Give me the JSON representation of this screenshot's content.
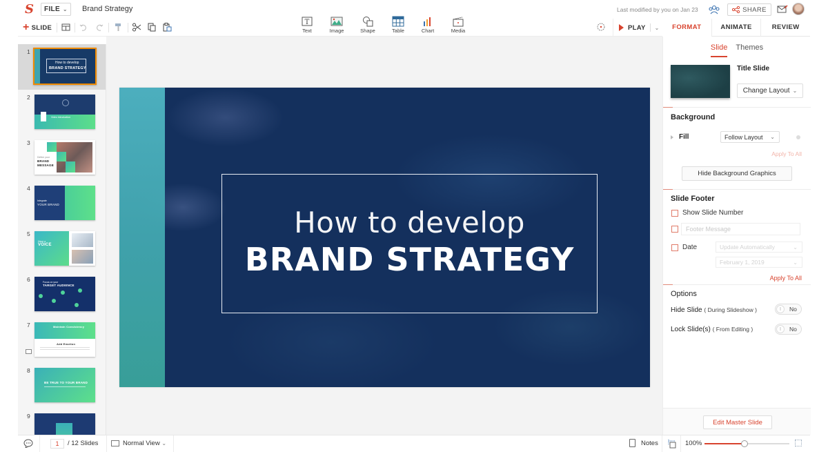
{
  "app": {
    "logo_glyph": "S",
    "file_menu_label": "FILE",
    "document_title": "Brand Strategy",
    "last_modified": "Last modified by you on Jan 23",
    "share_label": "SHARE"
  },
  "toolbar": {
    "add_slide_label": "SLIDE",
    "insert_items": [
      {
        "label": "Text",
        "icon": "text-box-icon"
      },
      {
        "label": "Image",
        "icon": "image-icon"
      },
      {
        "label": "Shape",
        "icon": "shape-icon"
      },
      {
        "label": "Table",
        "icon": "table-icon"
      },
      {
        "label": "Chart",
        "icon": "chart-icon"
      },
      {
        "label": "Media",
        "icon": "media-icon"
      }
    ],
    "play_label": "PLAY"
  },
  "right_tabs": [
    {
      "label": "FORMAT",
      "active": true
    },
    {
      "label": "ANIMATE",
      "active": false
    },
    {
      "label": "REVIEW",
      "active": false
    }
  ],
  "slides": [
    {
      "number": "1",
      "title_line1": "How to develop",
      "title_line2": "BRAND STRATEGY",
      "selected": true
    },
    {
      "number": "2",
      "caption": "Video introduction"
    },
    {
      "number": "3",
      "title": "BRAND MESSAGE",
      "kicker": "Define your"
    },
    {
      "number": "4",
      "title": "YOUR BRAND",
      "kicker": "Integrate"
    },
    {
      "number": "5",
      "title": "VOICE",
      "kicker": "Have a"
    },
    {
      "number": "6",
      "title": "TARGET AUDIENCE",
      "kicker": "Focus on your"
    },
    {
      "number": "7",
      "title": "Maintain Consistency",
      "subtitle": "Add Emotion"
    },
    {
      "number": "8",
      "title": "BE TRUE TO YOUR BRAND"
    },
    {
      "number": "9"
    }
  ],
  "current_slide": {
    "line1": "How to develop",
    "line2": "BRAND STRATEGY"
  },
  "format_panel": {
    "subtabs": [
      {
        "label": "Slide",
        "active": true
      },
      {
        "label": "Themes",
        "active": false
      }
    ],
    "layout_name": "Title Slide",
    "change_layout_label": "Change Layout",
    "background": {
      "title": "Background",
      "fill_label": "Fill",
      "fill_value": "Follow Layout",
      "apply_all_label": "Apply To All",
      "hide_graphics_label": "Hide Background Graphics"
    },
    "footer": {
      "title": "Slide Footer",
      "show_slide_number_label": "Show Slide Number",
      "show_slide_number_checked": false,
      "footer_message_placeholder": "Footer Message",
      "footer_message_checked": false,
      "date_label": "Date",
      "date_checked": false,
      "date_mode": "Update Automatically",
      "date_value": "February 1, 2019",
      "apply_all_label": "Apply To All"
    },
    "options": {
      "title": "Options",
      "hide_slide_label": "Hide Slide",
      "hide_slide_hint": "( During Slideshow )",
      "hide_slide_value": "No",
      "lock_slide_label": "Lock Slide(s)",
      "lock_slide_hint": "( From Editing )",
      "lock_slide_value": "No"
    },
    "edit_master_label": "Edit Master Slide"
  },
  "statusbar": {
    "current_page": "1",
    "total_pages": "/ 12 Slides",
    "view_mode": "Normal View",
    "notes_label": "Notes",
    "zoom_label": "100%",
    "zoom_fraction": 0.47
  },
  "colors": {
    "accent": "#d8432e",
    "selected_thumb_border": "#f08a00",
    "slide_background": "#15305e",
    "slide_strip": "#45acb5"
  }
}
